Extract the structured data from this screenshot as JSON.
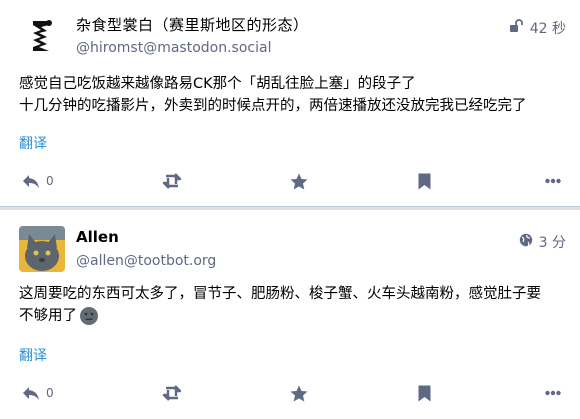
{
  "statuses": [
    {
      "display_name": "杂食型裳白（赛里斯地区的形态）",
      "acct": "@hiromst@mastodon.social",
      "visibility_icon": "lock-open-icon",
      "time": "42 秒",
      "content_lines": [
        "感觉自己吃饭越来越像路易CK那个「胡乱往脸上塞」的段子了",
        "十几分钟的吃播影片，外卖到的时候点开的，两倍速播放还没放完我已经吃完了"
      ],
      "translate_label": "翻译",
      "reply_count": "0"
    },
    {
      "display_name": "Allen",
      "acct": "@allen@tootbot.org",
      "visibility_icon": "globe-icon",
      "time": "3 分",
      "content_lines": [
        "这周要吃的东西可太多了，冒节子、肥肠粉、梭子蟹、火车头越南粉，感觉肚子要",
        "不够用了"
      ],
      "emoji": "neutral-face-emoji",
      "translate_label": "翻译",
      "reply_count": "0"
    }
  ],
  "colors": {
    "accent": "#2b90d9",
    "icon": "#606984",
    "separator": "#d9e1e8"
  }
}
